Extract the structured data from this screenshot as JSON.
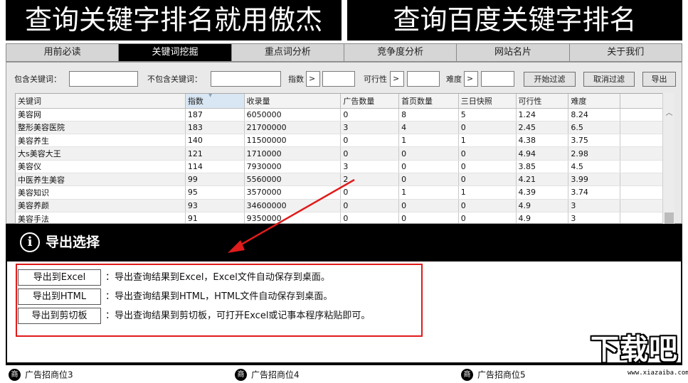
{
  "banners": {
    "left": "查询关键字排名就用傲杰",
    "right": "查询百度关键字排名"
  },
  "nav": {
    "tabs": [
      {
        "label": "用前必读"
      },
      {
        "label": "关键词挖掘"
      },
      {
        "label": "重点词分析"
      },
      {
        "label": "竞争度分析"
      },
      {
        "label": "网站名片"
      },
      {
        "label": "关于我们"
      }
    ],
    "active_index": 1
  },
  "filters": {
    "include_label": "包含关键词：",
    "include_value": "",
    "exclude_label": "不包含关键词：",
    "exclude_value": "",
    "index_label": "指数",
    "index_op": ">",
    "index_value": "",
    "feasibility_label": "可行性",
    "feasibility_op": ">",
    "feasibility_value": "",
    "difficulty_label": "难度",
    "difficulty_op": ">",
    "difficulty_value": "",
    "start_filter": "开始过滤",
    "cancel_filter": "取消过滤",
    "export": "导出"
  },
  "table": {
    "columns": [
      "关键词",
      "指数",
      "收录量",
      "广告数量",
      "首页数量",
      "三日快照",
      "可行性",
      "难度"
    ],
    "sorted_column": 1,
    "rows": [
      [
        "美容网",
        "187",
        "6050000",
        "0",
        "8",
        "5",
        "1.24",
        "8.24"
      ],
      [
        "整形美容医院",
        "183",
        "21700000",
        "3",
        "4",
        "0",
        "2.45",
        "6.5"
      ],
      [
        "美容养生",
        "140",
        "11500000",
        "0",
        "1",
        "1",
        "4.38",
        "3.75"
      ],
      [
        "大s美容大王",
        "121",
        "1710000",
        "0",
        "0",
        "0",
        "4.94",
        "2.98"
      ],
      [
        "美容仪",
        "114",
        "7930000",
        "3",
        "0",
        "0",
        "3.85",
        "4.5"
      ],
      [
        "中医养生美容",
        "99",
        "5560000",
        "2",
        "0",
        "0",
        "4.21",
        "3.99"
      ],
      [
        "美容知识",
        "95",
        "3570000",
        "0",
        "1",
        "1",
        "4.39",
        "3.74"
      ],
      [
        "美容养颜",
        "93",
        "34600000",
        "0",
        "0",
        "0",
        "4.9",
        "3"
      ],
      [
        "美容手法",
        "91",
        "9350000",
        "0",
        "0",
        "0",
        "4.9",
        "3"
      ]
    ]
  },
  "dialog": {
    "title": "导出选择",
    "icon": "info-icon",
    "options": [
      {
        "button": "导出到Excel",
        "desc": "：导出查询结果到Excel，Excel文件自动保存到桌面。"
      },
      {
        "button": "导出到HTML",
        "desc": "：导出查询结果到HTML，HTML文件自动保存到桌面。"
      },
      {
        "button": "导出到剪切板",
        "desc": "：导出查询结果到剪切板，可打开Excel或记事本程序粘贴即可。"
      }
    ],
    "highlight_color": "#e01b1b"
  },
  "ads": [
    {
      "icon": "商",
      "label": "广告招商位3"
    },
    {
      "icon": "商",
      "label": "广告招商位4"
    },
    {
      "icon": "商",
      "label": "广告招商位5"
    }
  ],
  "watermark": {
    "big": "下载吧",
    "small": "www.xiazaiba.com"
  },
  "colors": {
    "banner_bg": "#000000",
    "active_tab_bg": "#000000",
    "arrow": "#e01b1b"
  }
}
